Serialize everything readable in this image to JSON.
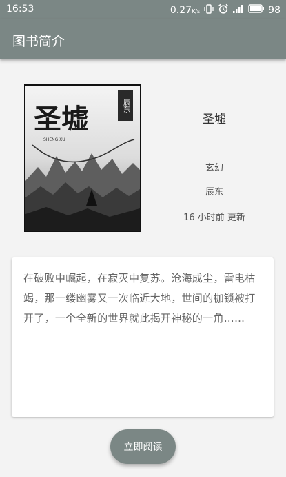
{
  "status_bar": {
    "time": "16:53",
    "data_rate": "0.27",
    "data_unit": "K/s",
    "battery": "98",
    "icons": [
      "vibrate-icon",
      "alarm-icon",
      "signal-icon",
      "battery-icon"
    ]
  },
  "app_bar": {
    "title": "图书简介"
  },
  "book": {
    "cover_title": "圣墟",
    "cover_seal": "辰东",
    "cover_pinyin": "SHENG XU",
    "name": "圣墟",
    "genre": "玄幻",
    "author": "辰东",
    "updated": "16 小时前 更新"
  },
  "description": "在破败中崛起，在寂灭中复苏。沧海成尘，雷电枯竭，那一缕幽雾又一次临近大地，世间的枷锁被打开了，一个全新的世界就此揭开神秘的一角……",
  "actions": {
    "read_label": "立即阅读"
  },
  "colors": {
    "primary": "#7b8785",
    "background": "#f3f3f3",
    "card": "#ffffff"
  }
}
